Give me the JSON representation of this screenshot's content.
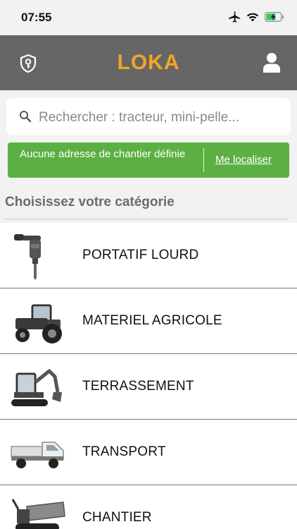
{
  "status_bar": {
    "time": "07:55"
  },
  "header": {
    "logo": "LOKA"
  },
  "search": {
    "placeholder": "Rechercher : tracteur, mini-pelle..."
  },
  "location": {
    "message": "Aucune adresse de chantier définie",
    "action": "Me localiser"
  },
  "section": {
    "title": "Choisissez votre catégorie"
  },
  "categories": [
    {
      "label": "PORTATIF LOURD",
      "icon": "jackhammer-icon"
    },
    {
      "label": "MATERIEL AGRICOLE",
      "icon": "tractor-icon"
    },
    {
      "label": "TERRASSEMENT",
      "icon": "excavator-icon"
    },
    {
      "label": "TRANSPORT",
      "icon": "truck-icon"
    },
    {
      "label": "CHANTIER",
      "icon": "dumper-icon"
    }
  ],
  "colors": {
    "header_bg": "#666666",
    "brand": "#f4a623",
    "banner": "#5cb043"
  }
}
